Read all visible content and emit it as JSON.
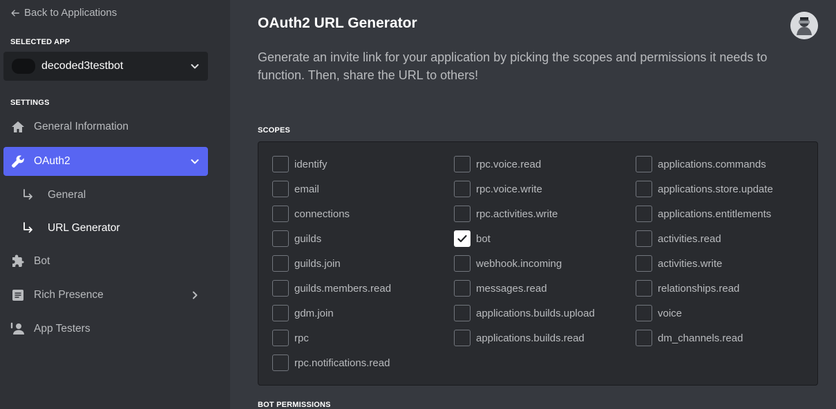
{
  "sidebar": {
    "back_label": "Back to Applications",
    "selected_app_heading": "SELECTED APP",
    "app_name": "decoded3testbot",
    "settings_heading": "SETTINGS",
    "nav": {
      "general_information": "General Information",
      "oauth2": "OAuth2",
      "general": "General",
      "url_generator": "URL Generator",
      "bot": "Bot",
      "rich_presence": "Rich Presence",
      "app_testers": "App Testers"
    }
  },
  "main": {
    "title": "OAuth2 URL Generator",
    "description": "Generate an invite link for your application by picking the scopes and permissions it needs to function. Then, share the URL to others!",
    "scopes_heading": "SCOPES",
    "bot_permissions_heading": "BOT PERMISSIONS"
  },
  "scopes": {
    "col1": [
      {
        "label": "identify",
        "checked": false
      },
      {
        "label": "email",
        "checked": false
      },
      {
        "label": "connections",
        "checked": false
      },
      {
        "label": "guilds",
        "checked": false
      },
      {
        "label": "guilds.join",
        "checked": false
      },
      {
        "label": "guilds.members.read",
        "checked": false
      },
      {
        "label": "gdm.join",
        "checked": false
      },
      {
        "label": "rpc",
        "checked": false
      },
      {
        "label": "rpc.notifications.read",
        "checked": false
      }
    ],
    "col2": [
      {
        "label": "rpc.voice.read",
        "checked": false
      },
      {
        "label": "rpc.voice.write",
        "checked": false
      },
      {
        "label": "rpc.activities.write",
        "checked": false
      },
      {
        "label": "bot",
        "checked": true
      },
      {
        "label": "webhook.incoming",
        "checked": false
      },
      {
        "label": "messages.read",
        "checked": false
      },
      {
        "label": "applications.builds.upload",
        "checked": false
      },
      {
        "label": "applications.builds.read",
        "checked": false
      }
    ],
    "col3": [
      {
        "label": "applications.commands",
        "checked": false
      },
      {
        "label": "applications.store.update",
        "checked": false
      },
      {
        "label": "applications.entitlements",
        "checked": false
      },
      {
        "label": "activities.read",
        "checked": false
      },
      {
        "label": "activities.write",
        "checked": false
      },
      {
        "label": "relationships.read",
        "checked": false
      },
      {
        "label": "voice",
        "checked": false
      },
      {
        "label": "dm_channels.read",
        "checked": false
      }
    ]
  },
  "colors": {
    "accent": "#5865f2",
    "sidebar_bg": "#2f3136",
    "main_bg": "#36393f"
  }
}
